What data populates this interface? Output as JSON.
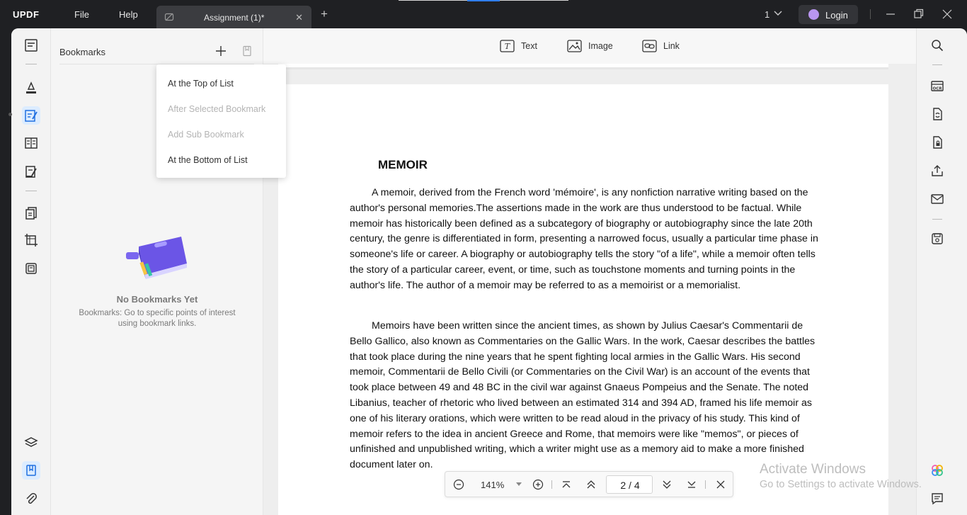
{
  "app": {
    "logo": "UPDF"
  },
  "menu": {
    "file": "File",
    "help": "Help"
  },
  "tab": {
    "title": "Assignment (1)*"
  },
  "titlebar": {
    "doc_count": "1",
    "login_label": "Login"
  },
  "toolbar": {
    "text_label": "Text",
    "image_label": "Image",
    "link_label": "Link"
  },
  "bookmarks": {
    "title": "Bookmarks",
    "empty_title": "No Bookmarks Yet",
    "empty_description": "Bookmarks: Go to specific points of interest using bookmark links."
  },
  "add_bookmark_menu": {
    "items": [
      {
        "label": "At the Top of List",
        "enabled": true
      },
      {
        "label": "After Selected Bookmark",
        "enabled": false
      },
      {
        "label": "Add Sub Bookmark",
        "enabled": false
      },
      {
        "label": "At the Bottom of List",
        "enabled": true
      }
    ]
  },
  "document": {
    "heading": "MEMOIR",
    "paragraphs": [
      "A memoir, derived from the French word 'mémoire', is any nonfiction narrative writing based on the author's personal memories.The assertions made in the work are thus understood to be factual. While memoir has historically been defined as a subcategory of biography or autobiography since the late 20th century, the genre is differentiated in form, presenting a narrowed focus, usually a particular time phase in someone's life or career. A biography or autobiography tells the story \"of a life\", while a memoir often tells the story of a particular career, event, or time, such as touchstone moments and turning points in the author's life. The author of a memoir may be referred to as a memoirist or a memorialist.",
      "Memoirs have been written since the ancient times, as shown by Julius Caesar's Commentarii de Bello Gallico, also known as Commentaries on the Gallic Wars. In the work, Caesar describes the battles that took place during the nine years that he spent fighting local armies in the Gallic Wars. His second memoir, Commentarii de Bello Civili (or Commentaries on the Civil War) is an account of the events that took place between 49 and 48 BC in the civil war against Gnaeus Pompeius and the Senate. The noted Libanius, teacher of rhetoric who lived between an estimated 314 and 394 AD, framed his life memoir as one of his literary orations, which were written to be read aloud in the privacy of his study. This kind of memoir refers to the idea in ancient Greece and Rome, that memoirs were like \"memos\", or pieces of unfinished and unpublished writing, which a writer might use as a memory aid to make a more finished document later on."
    ]
  },
  "pager": {
    "zoom": "141%",
    "current_page": "2",
    "separator": "/",
    "total_pages": "4"
  },
  "watermark": {
    "line1": "Activate Windows",
    "line2": "Go to Settings to activate Windows."
  },
  "colors": {
    "accent": "#2f7ef5",
    "titlebar_bg": "#1f2023",
    "active_tool_bg": "#dcecff",
    "disabled_text": "#b4b4b4"
  }
}
